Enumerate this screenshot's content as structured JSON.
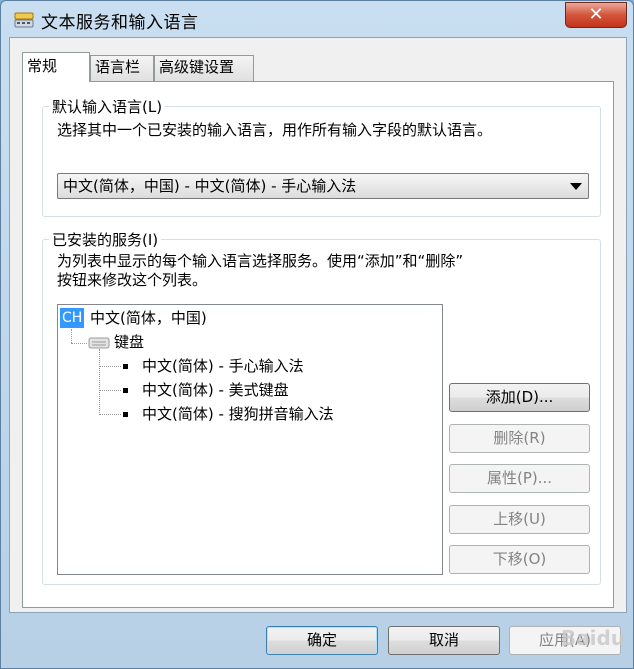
{
  "window": {
    "title": "文本服务和输入语言",
    "close_glyph": "✕"
  },
  "tabs": [
    {
      "label": "常规",
      "active": true
    },
    {
      "label": "语言栏",
      "active": false
    },
    {
      "label": "高级键设置",
      "active": false
    }
  ],
  "default_language": {
    "group_title": "默认输入语言(L)",
    "description": "选择其中一个已安装的输入语言，用作所有输入字段的默认语言。",
    "selected": "中文(简体，中国) - 中文(简体) - 手心输入法"
  },
  "installed_services": {
    "group_title": "已安装的服务(I)",
    "description_line1": "为列表中显示的每个输入语言选择服务。使用“添加”和“删除”",
    "description_line2": "按钮来修改这个列表。",
    "tree": {
      "language_badge": "CH",
      "language_label": "中文(简体，中国)",
      "category_label": "键盘",
      "items": [
        "中文(简体) - 手心输入法",
        "中文(简体) - 美式键盘",
        "中文(简体) - 搜狗拼音输入法"
      ]
    },
    "buttons": {
      "add": "添加(D)...",
      "remove": "删除(R)",
      "properties": "属性(P)...",
      "move_up": "上移(U)",
      "move_down": "下移(O)"
    }
  },
  "footer": {
    "ok": "确定",
    "cancel": "取消",
    "apply": "应用(A)"
  },
  "watermark": "Baidu"
}
